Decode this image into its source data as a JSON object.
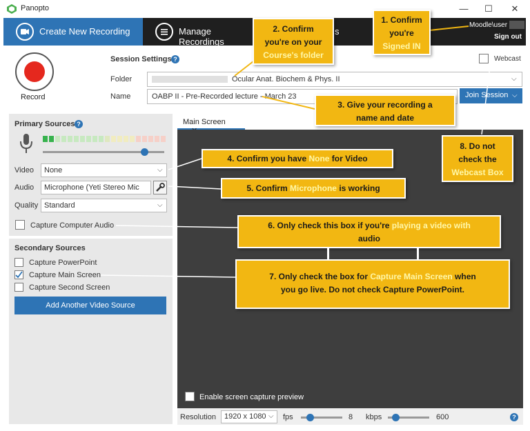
{
  "window": {
    "title": "Panopto",
    "minimize": "—",
    "maximize": "☐",
    "close": "✕"
  },
  "tabs": {
    "create": "Create New Recording",
    "manage": "Manage Recordings",
    "manage_suffix": "s"
  },
  "user": {
    "name": "Moodle\\user",
    "sign_out": "Sign out"
  },
  "record": {
    "label": "Record"
  },
  "session": {
    "title": "Session Settings",
    "folder_label": "Folder",
    "folder_value": "Ocular Anat. Biochem & Phys. II",
    "name_label": "Name",
    "name_value": "OABP II - Pre-Recorded lecture - March 23",
    "join_label": "Join Session",
    "webcast_label": "Webcast"
  },
  "primary": {
    "title": "Primary Sources",
    "video_label": "Video",
    "video_value": "None",
    "audio_label": "Audio",
    "audio_value": "Microphone (Yeti Stereo Mic",
    "quality_label": "Quality",
    "quality_value": "Standard",
    "capture_audio": "Capture Computer Audio"
  },
  "secondary": {
    "title": "Secondary Sources",
    "items": [
      {
        "label": "Capture PowerPoint",
        "checked": false
      },
      {
        "label": "Capture Main Screen",
        "checked": true
      },
      {
        "label": "Capture Second Screen",
        "checked": false
      }
    ],
    "add_button": "Add Another Video Source"
  },
  "preview": {
    "tab": "Main Screen",
    "tab_close": "✕",
    "enable_label": "Enable screen capture preview"
  },
  "bottom": {
    "resolution_label": "Resolution",
    "resolution_value": "1920 x 1080",
    "fps_label": "fps",
    "fps_value": "8",
    "kbps_label": "kbps",
    "kbps_value": "600",
    "help": "?"
  },
  "callouts": {
    "c1": {
      "l1": "1. Confirm",
      "l2": "you're",
      "l3": "Signed IN"
    },
    "c2": {
      "l1": "2. Confirm",
      "l2": "you're on your",
      "l3": "Course's folder"
    },
    "c3": {
      "l1": "3. Give your recording a",
      "l2": "name and date"
    },
    "c4": {
      "pre": "4. Confirm you have ",
      "hl": "None",
      "post": " for Video"
    },
    "c5": {
      "pre": "5. Confirm ",
      "hl": "Microphone",
      "post": " is working"
    },
    "c6": {
      "pre": "6. Only check this box if you're ",
      "hl": "playing a video with",
      "l2": "audio"
    },
    "c7": {
      "pre": "7. Only check the box for ",
      "hl": "Capture Main Screen",
      "post": " when",
      "l2": "you go live. Do not check Capture PowerPoint."
    },
    "c8": {
      "l1": "8. Do not",
      "l2": "check the",
      "l3": "Webcast Box"
    }
  },
  "colors": {
    "accent": "#2e74b5",
    "record": "#e5281e",
    "callout": "#f2b712",
    "dark_bar": "#1f1f1f"
  },
  "icons": [
    "panopto-logo-icon",
    "camera-icon",
    "list-icon",
    "help-icon",
    "microphone-icon",
    "wrench-icon",
    "chevron-down-icon",
    "checkmark-icon"
  ]
}
